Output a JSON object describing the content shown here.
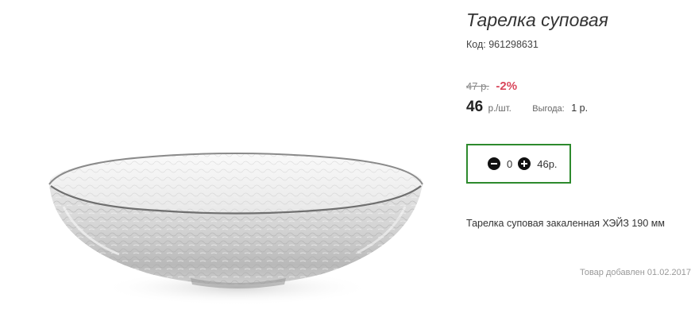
{
  "product": {
    "title": "Тарелка суповая",
    "code_label": "Код:",
    "code_value": "961298631",
    "old_price": "47 р.",
    "discount": "-2%",
    "price": "46",
    "unit": "р./шт.",
    "savings_label": "Выгода:",
    "savings_value": "1 р.",
    "description": "Тарелка суповая закаленная ХЭЙЗ 190 мм",
    "added_text": "Товар добавлен 01.02.2017",
    "image_icon": "glass-bowl-image"
  },
  "cart": {
    "quantity": "0",
    "total": "46р.",
    "minus_icon": "minus-circle-icon",
    "plus_icon": "plus-circle-icon",
    "accent_color": "#2d8a2d"
  },
  "colors": {
    "discount": "#d9465b",
    "muted": "#999999"
  }
}
